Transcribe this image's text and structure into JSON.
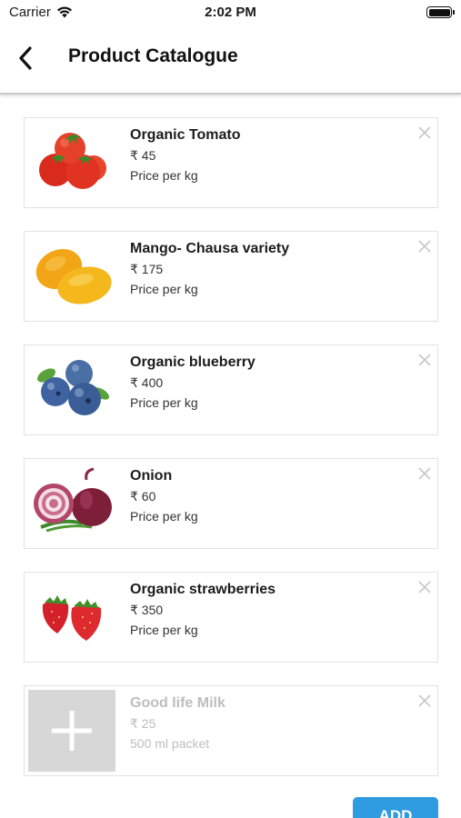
{
  "status_bar": {
    "carrier": "Carrier",
    "time": "2:02 PM",
    "wifi_icon": "wifi-icon",
    "battery_icon": "battery-icon"
  },
  "header": {
    "title": "Product Catalogue",
    "back_icon": "chevron-left-icon"
  },
  "products": [
    {
      "name": "Organic Tomato",
      "price": "₹ 45",
      "unit": "Price per kg",
      "image": "tomato"
    },
    {
      "name": "Mango- Chausa variety",
      "price": "₹ 175",
      "unit": "Price per kg",
      "image": "mango"
    },
    {
      "name": "Organic blueberry",
      "price": "₹ 400",
      "unit": "Price per kg",
      "image": "blueberry"
    },
    {
      "name": "Onion",
      "price": "₹ 60",
      "unit": "Price per kg",
      "image": "onion"
    },
    {
      "name": "Organic strawberries",
      "price": "₹ 350",
      "unit": "Price per kg",
      "image": "strawberry"
    },
    {
      "name": "Good life Milk",
      "price": "₹ 25",
      "unit": "500 ml packet",
      "image": "placeholder-plus",
      "disabled": true
    }
  ],
  "colors": {
    "accent": "#2f9be0",
    "disabled_text": "#bdbdbd",
    "placeholder_bg": "#d7d7d7"
  },
  "footer": {
    "add_label": "ADD"
  }
}
